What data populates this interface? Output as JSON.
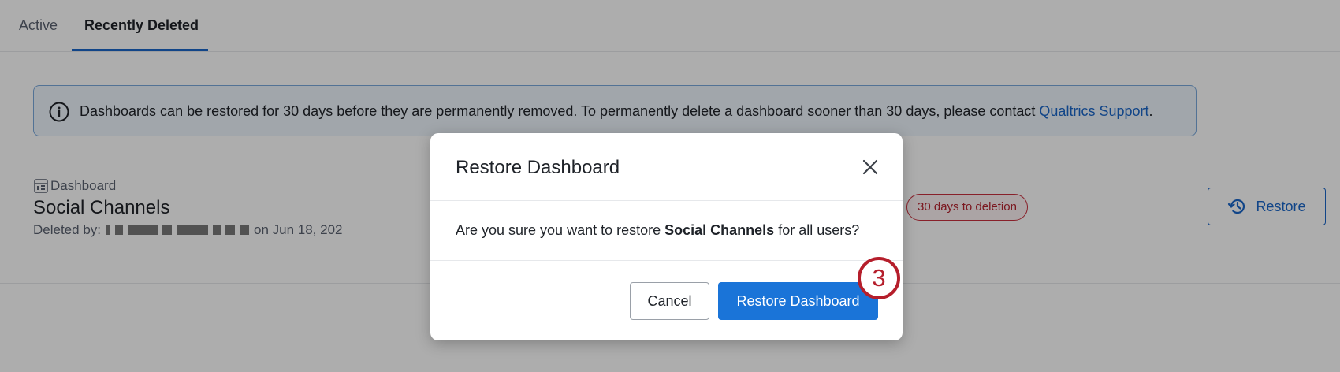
{
  "tabs": [
    {
      "label": "Active"
    },
    {
      "label": "Recently Deleted"
    }
  ],
  "banner": {
    "text": "Dashboards can be restored for 30 days before they are permanently removed. To permanently delete a dashboard sooner than 30 days, please contact ",
    "link_text": "Qualtrics Support",
    "suffix": ".",
    "icon": "info-icon"
  },
  "dashboard": {
    "type_label": "Dashboard",
    "title": "Social Channels",
    "deleted_prefix": "Deleted by:",
    "deleted_suffix": "on Jun 18, 202",
    "deletion_badge": "30 days to deletion",
    "restore_label": "Restore"
  },
  "modal": {
    "title": "Restore Dashboard",
    "message_prefix": "Are you sure you want to restore ",
    "message_bold": "Social Channels",
    "message_suffix": " for all users?",
    "cancel_label": "Cancel",
    "confirm_label": "Restore Dashboard"
  },
  "step_marker": "3",
  "colors": {
    "accent": "#1a74d8",
    "danger": "#b51e2b",
    "banner_bg": "#eef5fc"
  }
}
